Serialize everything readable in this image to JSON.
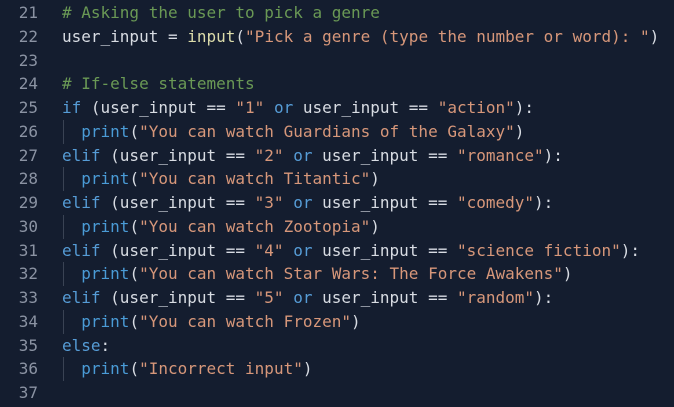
{
  "editor": {
    "colors": {
      "background": "#141d2f",
      "comment": "#6a9955",
      "string": "#d7977a",
      "keyword": "#569cd6",
      "function": "#dcdcaa"
    },
    "lines": [
      {
        "n": "21",
        "indent": false,
        "tokens": [
          [
            "comment",
            "# Asking the user to pick a genre"
          ]
        ]
      },
      {
        "n": "22",
        "indent": false,
        "tokens": [
          [
            "plain",
            "user_input = "
          ],
          [
            "func",
            "input"
          ],
          [
            "plain",
            "("
          ],
          [
            "string",
            "\"Pick a genre (type the number or word): \""
          ],
          [
            "plain",
            ")"
          ]
        ]
      },
      {
        "n": "23",
        "indent": false,
        "tokens": []
      },
      {
        "n": "24",
        "indent": false,
        "tokens": [
          [
            "comment",
            "# If-else statements"
          ]
        ]
      },
      {
        "n": "25",
        "indent": false,
        "tokens": [
          [
            "keyword",
            "if"
          ],
          [
            "plain",
            " (user_input == "
          ],
          [
            "string",
            "\"1\""
          ],
          [
            "plain",
            " "
          ],
          [
            "keyword",
            "or"
          ],
          [
            "plain",
            " user_input == "
          ],
          [
            "string",
            "\"action\""
          ],
          [
            "plain",
            "):"
          ]
        ]
      },
      {
        "n": "26",
        "indent": true,
        "tokens": [
          [
            "plain",
            "  "
          ],
          [
            "builtin",
            "print"
          ],
          [
            "plain",
            "("
          ],
          [
            "string",
            "\"You can watch Guardians of the Galaxy\""
          ],
          [
            "plain",
            ")"
          ]
        ]
      },
      {
        "n": "27",
        "indent": false,
        "tokens": [
          [
            "keyword",
            "elif"
          ],
          [
            "plain",
            " (user_input == "
          ],
          [
            "string",
            "\"2\""
          ],
          [
            "plain",
            " "
          ],
          [
            "keyword",
            "or"
          ],
          [
            "plain",
            " user_input == "
          ],
          [
            "string",
            "\"romance\""
          ],
          [
            "plain",
            "):"
          ]
        ]
      },
      {
        "n": "28",
        "indent": true,
        "tokens": [
          [
            "plain",
            "  "
          ],
          [
            "builtin",
            "print"
          ],
          [
            "plain",
            "("
          ],
          [
            "string",
            "\"You can watch Titantic\""
          ],
          [
            "plain",
            ")"
          ]
        ]
      },
      {
        "n": "29",
        "indent": false,
        "tokens": [
          [
            "keyword",
            "elif"
          ],
          [
            "plain",
            " (user_input == "
          ],
          [
            "string",
            "\"3\""
          ],
          [
            "plain",
            " "
          ],
          [
            "keyword",
            "or"
          ],
          [
            "plain",
            " user_input == "
          ],
          [
            "string",
            "\"comedy\""
          ],
          [
            "plain",
            "):"
          ]
        ]
      },
      {
        "n": "30",
        "indent": true,
        "tokens": [
          [
            "plain",
            "  "
          ],
          [
            "builtin",
            "print"
          ],
          [
            "plain",
            "("
          ],
          [
            "string",
            "\"You can watch Zootopia\""
          ],
          [
            "plain",
            ")"
          ]
        ]
      },
      {
        "n": "31",
        "indent": false,
        "tokens": [
          [
            "keyword",
            "elif"
          ],
          [
            "plain",
            " (user_input == "
          ],
          [
            "string",
            "\"4\""
          ],
          [
            "plain",
            " "
          ],
          [
            "keyword",
            "or"
          ],
          [
            "plain",
            " user_input == "
          ],
          [
            "string",
            "\"science fiction\""
          ],
          [
            "plain",
            "):"
          ]
        ]
      },
      {
        "n": "32",
        "indent": true,
        "tokens": [
          [
            "plain",
            "  "
          ],
          [
            "builtin",
            "print"
          ],
          [
            "plain",
            "("
          ],
          [
            "string",
            "\"You can watch Star Wars: The Force Awakens\""
          ],
          [
            "plain",
            ")"
          ]
        ]
      },
      {
        "n": "33",
        "indent": false,
        "tokens": [
          [
            "keyword",
            "elif"
          ],
          [
            "plain",
            " (user_input == "
          ],
          [
            "string",
            "\"5\""
          ],
          [
            "plain",
            " "
          ],
          [
            "keyword",
            "or"
          ],
          [
            "plain",
            " user_input == "
          ],
          [
            "string",
            "\"random\""
          ],
          [
            "plain",
            "):"
          ]
        ]
      },
      {
        "n": "34",
        "indent": true,
        "tokens": [
          [
            "plain",
            "  "
          ],
          [
            "builtin",
            "print"
          ],
          [
            "plain",
            "("
          ],
          [
            "string",
            "\"You can watch Frozen\""
          ],
          [
            "plain",
            ")"
          ]
        ]
      },
      {
        "n": "35",
        "indent": false,
        "tokens": [
          [
            "keyword",
            "else"
          ],
          [
            "plain",
            ":"
          ]
        ]
      },
      {
        "n": "36",
        "indent": true,
        "tokens": [
          [
            "plain",
            "  "
          ],
          [
            "builtin",
            "print"
          ],
          [
            "plain",
            "("
          ],
          [
            "string",
            "\"Incorrect input\""
          ],
          [
            "plain",
            ")"
          ]
        ]
      },
      {
        "n": "37",
        "indent": false,
        "tokens": []
      }
    ]
  }
}
